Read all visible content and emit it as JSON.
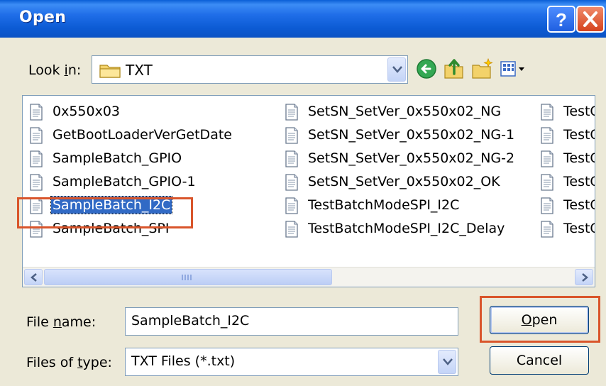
{
  "window": {
    "title": "Open"
  },
  "title_buttons": {
    "help": "help-icon",
    "close": "close-icon"
  },
  "lookin": {
    "label_pre": "Look ",
    "label_key": "i",
    "label_post": "n:",
    "value": "TXT"
  },
  "toolbar": {
    "icons": [
      "back-icon",
      "up-folder-icon",
      "new-folder-icon",
      "views-menu-icon"
    ]
  },
  "files": {
    "column1": [
      "0x550x03",
      "GetBootLoaderVerGetDate",
      "SampleBatch_GPIO",
      "SampleBatch_GPIO-1",
      "SampleBatch_I2C",
      "SampleBatch_SPI"
    ],
    "column2": [
      "SetSN_SetVer_0x550x02_NG",
      "SetSN_SetVer_0x550x02_NG-1",
      "SetSN_SetVer_0x550x02_NG-2",
      "SetSN_SetVer_0x550x02_OK",
      "TestBatchModeSPI_I2C",
      "TestBatchModeSPI_I2C_Delay"
    ],
    "column3": [
      "TestG",
      "TestG",
      "TestG",
      "TestG",
      "TestG",
      "TestG"
    ],
    "selected": "SampleBatch_I2C"
  },
  "filename": {
    "label_pre": "File ",
    "label_key": "n",
    "label_post": "ame:",
    "value": "SampleBatch_I2C"
  },
  "filetype": {
    "label_pre": "Files of ",
    "label_key": "t",
    "label_post": "ype:",
    "value": "TXT Files (*.txt)"
  },
  "buttons": {
    "open_key": "O",
    "open_rest": "pen",
    "cancel": "Cancel"
  },
  "colors": {
    "highlight": "#d9552b",
    "selection": "#316ac5",
    "titlebar": "#0b52c4"
  }
}
